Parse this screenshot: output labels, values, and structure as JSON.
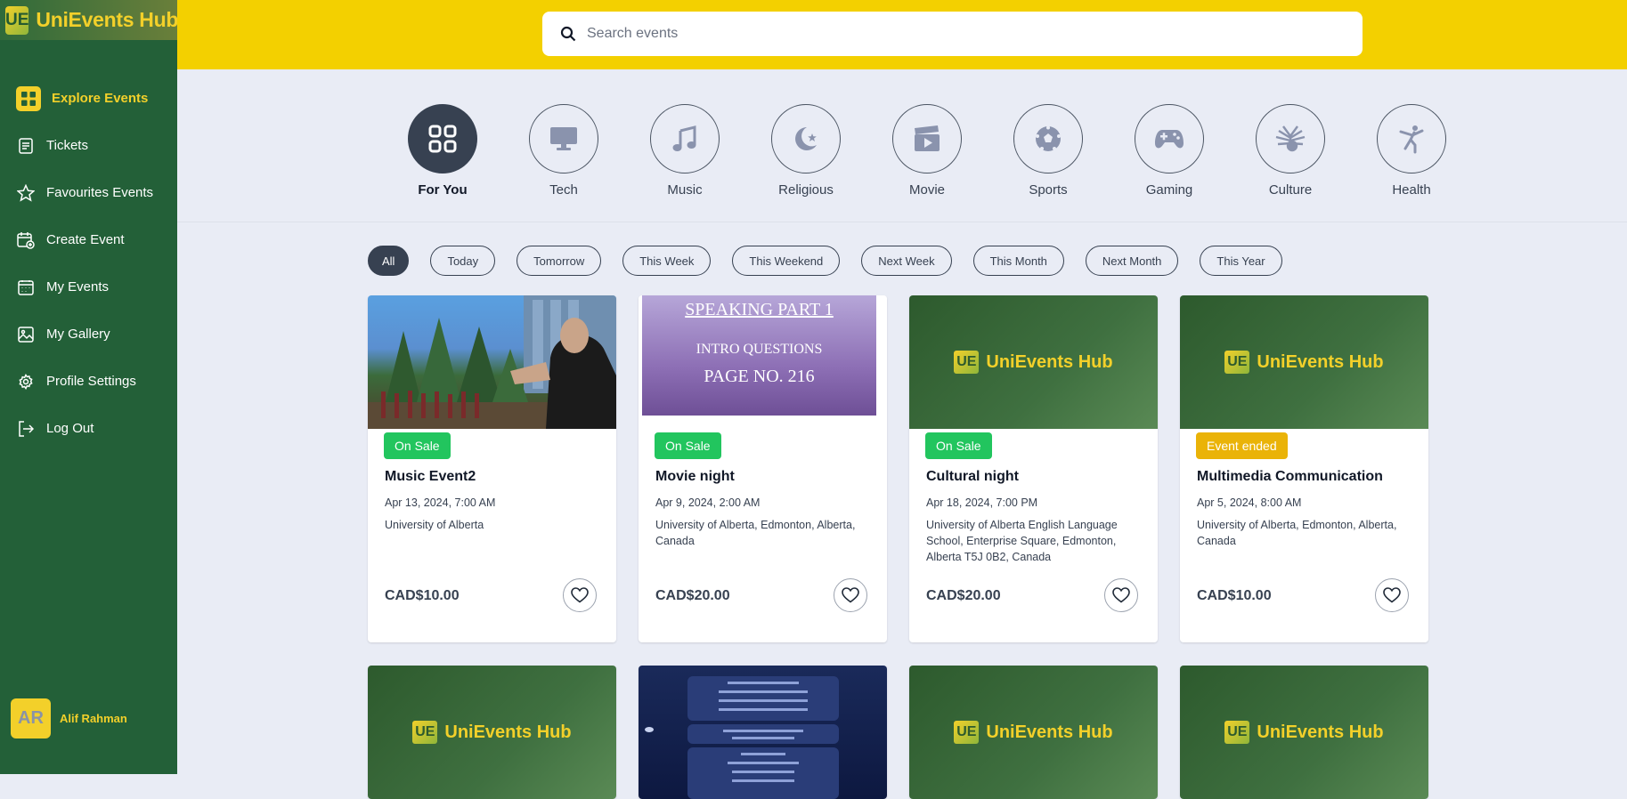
{
  "app": {
    "logo_mark": "UE",
    "name": "UniEvents Hub"
  },
  "sidebar": {
    "items": [
      {
        "label": "Explore Events",
        "icon": "grid-icon"
      },
      {
        "label": "Tickets",
        "icon": "document-icon"
      },
      {
        "label": "Favourites Events",
        "icon": "star-icon"
      },
      {
        "label": "Create Event",
        "icon": "calendar-plus-icon"
      },
      {
        "label": "My Events",
        "icon": "calendar-icon"
      },
      {
        "label": "My Gallery",
        "icon": "image-icon"
      },
      {
        "label": "Profile Settings",
        "icon": "gear-icon"
      },
      {
        "label": "Log Out",
        "icon": "logout-icon"
      }
    ],
    "user": {
      "initials": "AR",
      "name": "Alif Rahman"
    }
  },
  "search": {
    "placeholder": "Search events"
  },
  "categories": [
    {
      "label": "For You",
      "icon": "grid-icon"
    },
    {
      "label": "Tech",
      "icon": "monitor-icon"
    },
    {
      "label": "Music",
      "icon": "music-note-icon"
    },
    {
      "label": "Religious",
      "icon": "crescent-star-icon"
    },
    {
      "label": "Movie",
      "icon": "clapperboard-icon"
    },
    {
      "label": "Sports",
      "icon": "soccer-ball-icon"
    },
    {
      "label": "Gaming",
      "icon": "gamepad-icon"
    },
    {
      "label": "Culture",
      "icon": "headdress-icon"
    },
    {
      "label": "Health",
      "icon": "yoga-icon"
    }
  ],
  "filters": [
    "All",
    "Today",
    "Tomorrow",
    "This Week",
    "This Weekend",
    "Next Week",
    "This Month",
    "Next Month",
    "This Year"
  ],
  "cards": [
    {
      "title": "Music Event2",
      "date": "Apr 13, 2024, 7:00 AM",
      "location": "University of Alberta",
      "price": "CAD$10.00",
      "status": "On Sale"
    },
    {
      "title": "Movie night",
      "date": "Apr 9, 2024, 2:00 AM",
      "location": "University of Alberta, Edmonton, Alberta, Canada",
      "price": "CAD$20.00",
      "status": "On Sale",
      "image_text": {
        "line1": "SPEAKING PART 1",
        "line2": "INTRO QUESTIONS",
        "line3": "PAGE NO. 216"
      }
    },
    {
      "title": "Cultural night",
      "date": "Apr 18, 2024, 7:00 PM",
      "location": "University of Alberta English Language School, Enterprise Square, Edmonton, Alberta T5J 0B2, Canada",
      "price": "CAD$20.00",
      "status": "On Sale"
    },
    {
      "title": "Multimedia Communication",
      "date": "Apr 5, 2024, 8:00 AM",
      "location": "University of Alberta, Edmonton, Alberta, Canada",
      "price": "CAD$10.00",
      "status": "Event ended"
    }
  ],
  "colors": {
    "sidebar": "#236038",
    "accent": "#f3d000",
    "sale": "#22c55e",
    "ended": "#eab308",
    "dark": "#374151"
  }
}
